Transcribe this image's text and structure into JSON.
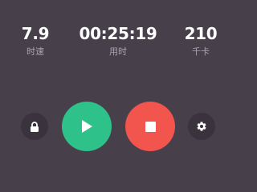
{
  "stats": [
    {
      "value": "7.9",
      "label": "时速"
    },
    {
      "value": "00:25:19",
      "label": "用时"
    },
    {
      "value": "210",
      "label": "千卡"
    }
  ],
  "controls": {
    "lock": {
      "icon": "lock-icon"
    },
    "play": {
      "icon": "play-icon"
    },
    "stop": {
      "icon": "stop-icon"
    },
    "settings": {
      "icon": "gear-icon"
    }
  },
  "colors": {
    "background": "#47404b",
    "play": "#2ec18a",
    "stop": "#f2554e"
  }
}
